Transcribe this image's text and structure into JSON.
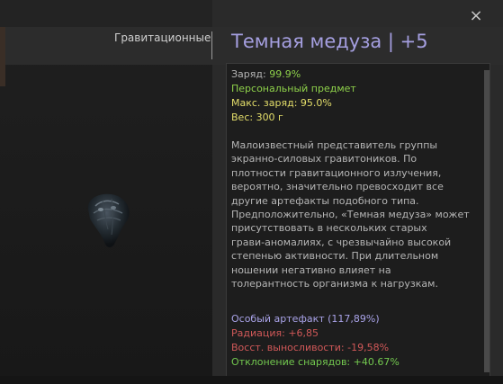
{
  "category_label": "Гравитационные",
  "title": "Темная медуза  |  +5",
  "close_label": "×",
  "stats": {
    "charge_label": "Заряд: ",
    "charge_value": "99.9%",
    "personal": "Персональный предмет",
    "max_charge": "Макс. заряд: 95.0%",
    "weight": "Вес: 300 г"
  },
  "description": [
    "Малоизвестный представитель группы",
    "экранно-силовых гравитоников. По",
    "плотности гравитационного излучения,",
    "вероятно, значительно превосходит все",
    "другие артефакты подобного типа.",
    "Предположительно, «Темная медуза» может",
    "присутствовать в нескольких старых",
    "грави-аномалиях, с чрезвычайно высокой",
    "степенью активности. При длительном",
    "ношении негативно влияет на",
    "толерантность организма к нагрузкам."
  ],
  "effects": {
    "special": "Особый артефакт (117,89%)",
    "radiation": "Радиация: +6,85",
    "stamina": "Восст. выносливости: -19,58%",
    "deflection": "Отклонение снарядов: +40.67%"
  },
  "colors": {
    "title": "#a59fe0",
    "positive": "#8ed14a",
    "negative": "#d05858",
    "special": "#a9a3e8",
    "highlight": "#e4de6a"
  },
  "icons": {
    "close": "close-icon",
    "artifact": "dark-jellyfish-artifact-icon"
  }
}
